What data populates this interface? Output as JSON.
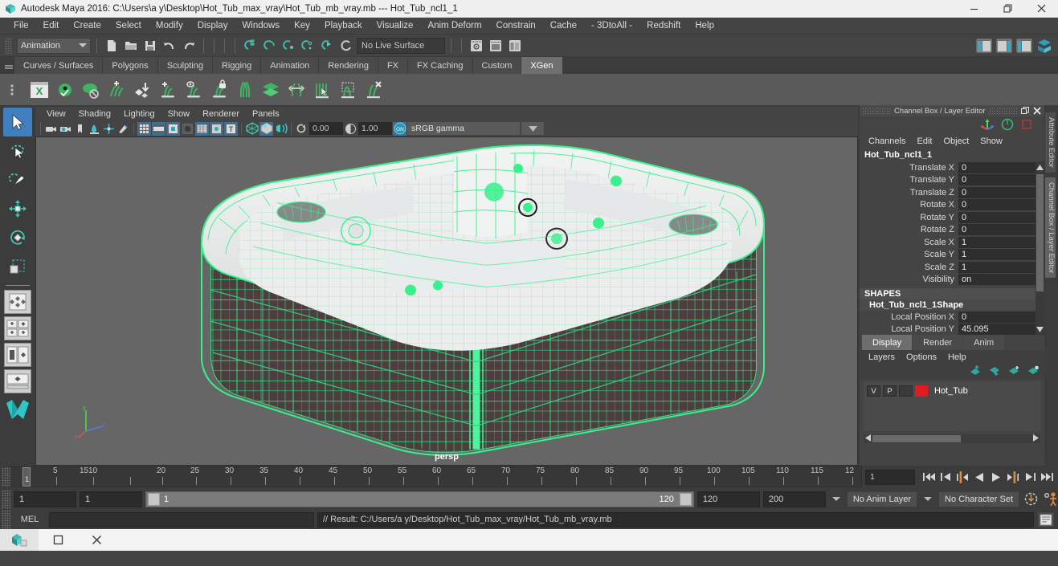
{
  "window": {
    "title": "Autodesk Maya 2016: C:\\Users\\a y\\Desktop\\Hot_Tub_max_vray\\Hot_Tub_mb_vray.mb  ---  Hot_Tub_ncl1_1",
    "icon": "maya-logo-icon",
    "minimize": "minimize-button",
    "maximize": "restore-button",
    "close": "close-button"
  },
  "menubar": {
    "items": [
      {
        "label": "File"
      },
      {
        "label": "Edit"
      },
      {
        "label": "Create"
      },
      {
        "label": "Select"
      },
      {
        "label": "Modify"
      },
      {
        "label": "Display"
      },
      {
        "label": "Windows"
      },
      {
        "label": "Key"
      },
      {
        "label": "Playback"
      },
      {
        "label": "Visualize"
      },
      {
        "label": "Anim Deform"
      },
      {
        "label": "Constrain"
      },
      {
        "label": "Cache"
      },
      {
        "label": "- 3DtoAll -"
      },
      {
        "label": "Redshift"
      },
      {
        "label": "Help"
      }
    ]
  },
  "statusbar": {
    "menu_set": "Animation",
    "live_surface": "No Live Surface",
    "icons": [
      "new-scene-icon",
      "open-scene-icon",
      "save-scene-icon",
      "undo-icon",
      "redo-icon",
      "select-by-hierarchy-icon",
      "select-by-object-icon",
      "select-by-component-icon",
      "snap-to-grid-icon",
      "snap-to-curve-icon",
      "snap-to-point-icon",
      "snap-to-projected-center-icon",
      "snap-to-view-plane-icon",
      "make-live-icon",
      "show-manipulator-icon",
      "attribute-editor-icon",
      "tool-settings-icon",
      "channel-box-icon"
    ]
  },
  "shelf": {
    "tabs": [
      {
        "label": "Curves / Surfaces",
        "active": false
      },
      {
        "label": "Polygons",
        "active": false
      },
      {
        "label": "Sculpting",
        "active": false
      },
      {
        "label": "Rigging",
        "active": false
      },
      {
        "label": "Animation",
        "active": false
      },
      {
        "label": "Rendering",
        "active": false
      },
      {
        "label": "FX",
        "active": false
      },
      {
        "label": "FX Caching",
        "active": false
      },
      {
        "label": "Custom",
        "active": false
      },
      {
        "label": "XGen",
        "active": true
      }
    ],
    "items": [
      "xgen-window-icon",
      "xgen-preview-icon",
      "xgen-hide-icon",
      "xgen-add-description-icon",
      "xgen-import-icon",
      "xgen-add-guide-icon",
      "xgen-guide-preview-icon",
      "xgen-lock-guide-icon",
      "xgen-comb-icon",
      "xgen-layers-icon",
      "xgen-length-icon",
      "xgen-select-guides-icon",
      "xgen-region-icon",
      "xgen-delete-guide-icon"
    ]
  },
  "toolbox": {
    "tools": [
      {
        "name": "select-tool",
        "active": true
      },
      {
        "name": "lasso-select-tool",
        "active": false
      },
      {
        "name": "paint-select-tool",
        "active": false
      },
      {
        "name": "move-tool",
        "active": false
      },
      {
        "name": "rotate-tool",
        "active": false
      },
      {
        "name": "scale-tool",
        "active": false
      }
    ],
    "quick_layouts": [
      "single-perspective-layout",
      "four-view-layout",
      "outliner-persp-layout",
      "hypergraph-persp-layout"
    ]
  },
  "viewport": {
    "menus": [
      {
        "label": "View"
      },
      {
        "label": "Shading"
      },
      {
        "label": "Lighting"
      },
      {
        "label": "Show"
      },
      {
        "label": "Renderer"
      },
      {
        "label": "Panels"
      }
    ],
    "exposure": "0.00",
    "gamma": "1.00",
    "gamma_toggle": "ON",
    "color_profile": "sRGB gamma",
    "camera_label": "persp",
    "toolbar_icons": [
      "select-camera-icon",
      "camera-attributes-icon",
      "bookmark-icon",
      "image-plane-icon",
      "two-sided-lighting-icon",
      "shadows-icon",
      "grid-toggle-icon",
      "film-gate-icon",
      "resolution-gate-icon",
      "gate-mask-icon",
      "xray-icon",
      "xray-joints-icon",
      "texture-toggle-icon",
      "smooth-shade-icon",
      "hardware-texturing-icon",
      "wireframe-on-shaded-icon"
    ],
    "model": {
      "name": "Hot_Tub_ncl1_1",
      "wireframe_color": "#38f08c",
      "surface_color": "#e8eaea",
      "panel_color": "#4a3c3c",
      "background_color": "#666666"
    }
  },
  "channel_box": {
    "panel_title": "Channel Box / Layer Editor",
    "menus": [
      {
        "label": "Channels"
      },
      {
        "label": "Edit"
      },
      {
        "label": "Object"
      },
      {
        "label": "Show"
      }
    ],
    "object_name": "Hot_Tub_ncl1_1",
    "attributes": [
      {
        "label": "Translate X",
        "value": "0"
      },
      {
        "label": "Translate Y",
        "value": "0"
      },
      {
        "label": "Translate Z",
        "value": "0"
      },
      {
        "label": "Rotate X",
        "value": "0"
      },
      {
        "label": "Rotate Y",
        "value": "0"
      },
      {
        "label": "Rotate Z",
        "value": "0"
      },
      {
        "label": "Scale X",
        "value": "1"
      },
      {
        "label": "Scale Y",
        "value": "1"
      },
      {
        "label": "Scale Z",
        "value": "1"
      },
      {
        "label": "Visibility",
        "value": "on"
      }
    ],
    "shapes_header": "SHAPES",
    "shape_name": "Hot_Tub_ncl1_1Shape",
    "shape_attributes": [
      {
        "label": "Local Position X",
        "value": "0"
      },
      {
        "label": "Local Position Y",
        "value": "45.095"
      }
    ]
  },
  "layer_editor": {
    "tabs": [
      {
        "label": "Display",
        "active": true
      },
      {
        "label": "Render",
        "active": false
      },
      {
        "label": "Anim",
        "active": false
      }
    ],
    "menus": [
      {
        "label": "Layers"
      },
      {
        "label": "Options"
      },
      {
        "label": "Help"
      }
    ],
    "toolbar_icons": [
      "move-layer-up-icon",
      "move-layer-down-icon",
      "new-layer-icon",
      "new-layer-from-selected-icon"
    ],
    "layers": [
      {
        "visibility": "V",
        "playback": "P",
        "shading": "",
        "color": "#e01b24",
        "name": "Hot_Tub"
      }
    ]
  },
  "right_tabs": [
    {
      "label": "Attribute Editor",
      "selected": false
    },
    {
      "label": "Channel Box / Layer Editor",
      "selected": true
    }
  ],
  "timeline": {
    "start": 1,
    "end": 120,
    "current_frame": "1",
    "tick_labels": [
      "5",
      "10",
      "15",
      "20",
      "25",
      "30",
      "35",
      "40",
      "45",
      "50",
      "55",
      "60",
      "65",
      "70",
      "75",
      "80",
      "85",
      "90",
      "95",
      "100",
      "105",
      "110",
      "115",
      "12"
    ],
    "frame_field": "1",
    "playback_buttons": [
      "go-to-start-icon",
      "step-back-keyframe-icon",
      "step-back-frame-icon",
      "play-backwards-icon",
      "play-forwards-icon",
      "step-forward-frame-icon",
      "step-forward-keyframe-icon",
      "go-to-end-icon"
    ]
  },
  "range_slider": {
    "anim_start": "1",
    "range_start": "1",
    "bar_start": "1",
    "bar_end": "120",
    "range_end": "120",
    "anim_end": "200",
    "anim_layer": "No Anim Layer",
    "character_set": "No Character Set",
    "auto_key_icon": "auto-keyframe-icon",
    "anim_prefs_icon": "animation-preferences-icon"
  },
  "command_line": {
    "language": "MEL",
    "input_value": "",
    "result": "// Result: C:/Users/a y/Desktop/Hot_Tub_max_vray/Hot_Tub_mb_vray.mb",
    "script_editor_icon": "script-editor-icon"
  },
  "taskbar": {
    "items": [
      "maya-taskbar-icon",
      "restore-taskbar-button",
      "close-taskbar-button"
    ]
  },
  "colors": {
    "accent_blue": "#3f7fbf",
    "teal": "#2fa8a0",
    "wire_green": "#38f08c",
    "layer_red": "#e01b24",
    "orange": "#d98a3a"
  }
}
